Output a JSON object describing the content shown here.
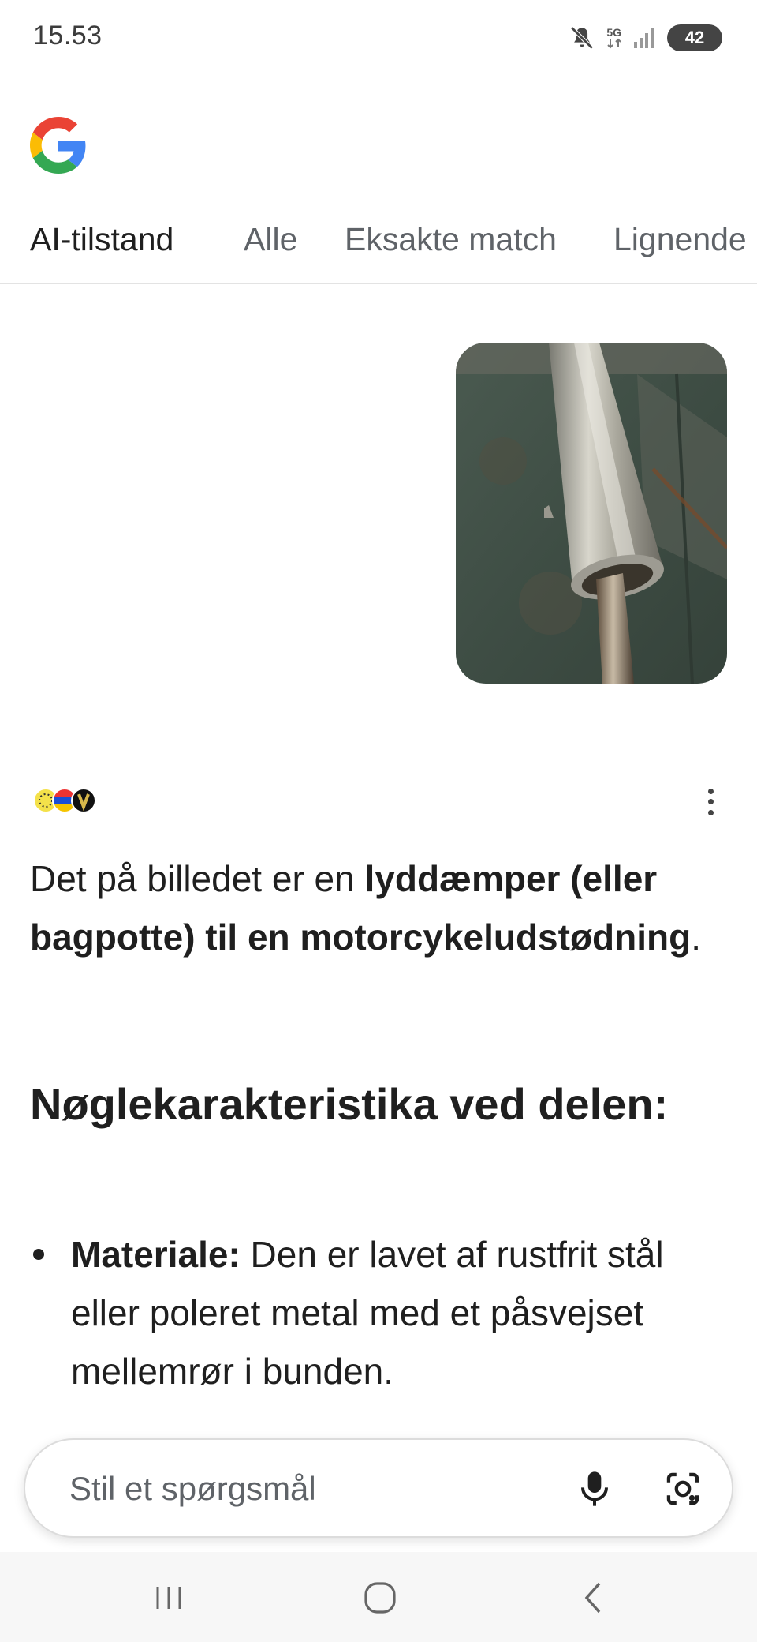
{
  "status_bar": {
    "time": "15.53",
    "network": "5G",
    "battery": "42"
  },
  "tabs": [
    {
      "label": "AI-tilstand",
      "active": true
    },
    {
      "label": "Alle",
      "active": false
    },
    {
      "label": "Eksakte match",
      "active": false
    },
    {
      "label": "Lignende",
      "active": false
    }
  ],
  "answer": {
    "p1_prefix": "Det på billedet er en ",
    "p1_bold": "lyddæmper (eller bagpotte) til en motorcykeludstødning",
    "p1_suffix": ".",
    "heading": "Nøglekarakteristika ved delen:",
    "bullets": [
      {
        "label": "Materiale:",
        "text": " Den er lavet af rustfrit stål eller poleret metal med et påsvejset mellemrør i bunden."
      }
    ]
  },
  "ask": {
    "placeholder": "Stil et spørgsmål"
  },
  "colors": {
    "google_blue": "#4285F4",
    "google_red": "#EA4335",
    "google_yellow": "#FBBC05",
    "google_green": "#34A853"
  }
}
